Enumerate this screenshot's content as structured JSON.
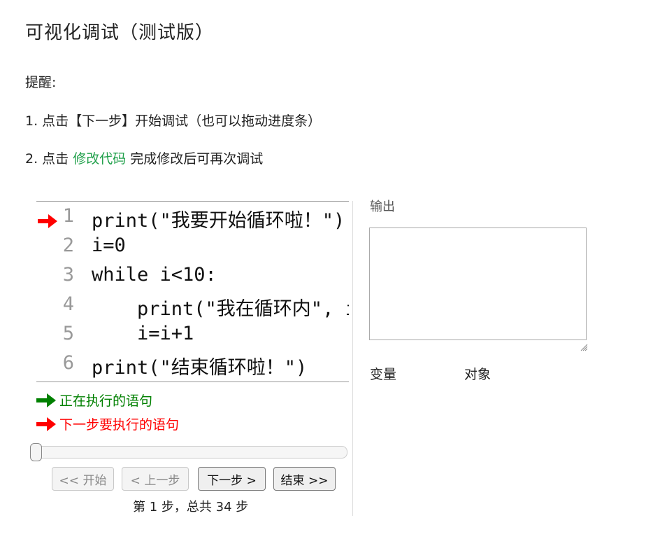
{
  "page": {
    "title": "可视化调试（测试版）",
    "tips": {
      "heading": "提醒:",
      "tip1": "1. 点击【下一步】开始调试（也可以拖动进度条）",
      "tip2_prefix": "2. 点击 ",
      "tip2_link": "修改代码",
      "tip2_suffix": " 完成修改后可再次调试"
    }
  },
  "code": {
    "lines": [
      {
        "num": "1",
        "text": "print(\"我要开始循环啦！\")"
      },
      {
        "num": "2",
        "text": "i=0"
      },
      {
        "num": "3",
        "text": "while i<10:"
      },
      {
        "num": "4",
        "text": "    print(\"我在循环内\", i)"
      },
      {
        "num": "5",
        "text": "    i=i+1"
      },
      {
        "num": "6",
        "text": "print(\"结束循环啦！\")"
      }
    ],
    "next_line": "1"
  },
  "legend": {
    "current": "正在执行的语句",
    "next": "下一步要执行的语句"
  },
  "controls": {
    "first": "<< 开始",
    "prev": "< 上一步",
    "next": "下一步 >",
    "last": "结束 >>",
    "step_counter": "第 1 步，总共 34 步",
    "progress": 0
  },
  "right_panel": {
    "output_label": "输出",
    "output_value": "",
    "variables_label": "变量",
    "objects_label": "对象"
  },
  "colors": {
    "current_arrow": "#008000",
    "next_arrow": "#ff0000",
    "link": "#21a04b"
  },
  "icons": {
    "next_line_marker": "red-arrow-icon",
    "current_line_marker": "green-arrow-icon",
    "resize_handle": "resize-grip-icon"
  }
}
